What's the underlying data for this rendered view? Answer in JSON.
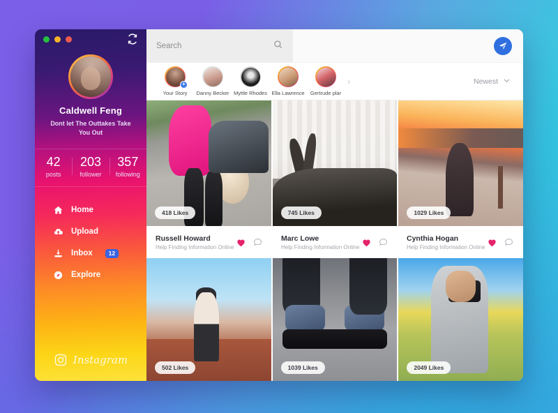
{
  "theme": {
    "bg_left": "#7b5fe8",
    "bg_right": "#35cbdf",
    "accent_blue": "#2f6fe0",
    "badge_blue": "#3a63e0",
    "heart_pink": "#e5236b"
  },
  "window": {
    "traffic_lights": [
      "green",
      "yellow",
      "red"
    ],
    "refresh_icon": "refresh-icon"
  },
  "sidebar": {
    "profile": {
      "name": "Caldwell Feng",
      "bio": "Dont let The Outtakes Take You Out",
      "avatar_icon": "user-avatar"
    },
    "stats": [
      {
        "num": "42",
        "label": "posts"
      },
      {
        "num": "203",
        "label": "follower"
      },
      {
        "num": "357",
        "label": "following"
      }
    ],
    "nav": [
      {
        "label": "Home",
        "icon": "home-icon",
        "badge": null
      },
      {
        "label": "Upload",
        "icon": "upload-cloud-icon",
        "badge": null
      },
      {
        "label": "Inbox",
        "icon": "inbox-download-icon",
        "badge": "12"
      },
      {
        "label": "Explore",
        "icon": "compass-icon",
        "badge": null
      }
    ],
    "brand": {
      "label": "Instagram",
      "icon": "instagram-icon"
    }
  },
  "topbar": {
    "search": {
      "value": "",
      "placeholder": "Search",
      "icon": "search-icon"
    },
    "send": {
      "icon": "send-paper-plane-icon"
    }
  },
  "stories": {
    "items": [
      {
        "name": "Your Story",
        "has_plus": true
      },
      {
        "name": "Danny Becker",
        "has_plus": false
      },
      {
        "name": "Myttle Rhodes",
        "has_plus": false
      },
      {
        "name": "Ella Lawrence",
        "has_plus": false
      },
      {
        "name": "Gertrude plar",
        "has_plus": false
      }
    ],
    "next_arrow": "chevron-right-icon",
    "sort": {
      "label": "Newest",
      "icon": "chevron-down-icon"
    }
  },
  "feed": {
    "rows": [
      {
        "posts": [
          {
            "likes": "418 Likes",
            "user": "Russell Howard",
            "caption": "Help Finding Information Online",
            "photo": "p1"
          },
          {
            "likes": "745 Likes",
            "user": "Marc Lowe",
            "caption": "Help Finding Information Online",
            "photo": "p2"
          },
          {
            "likes": "1029 Likes",
            "user": "Cynthia Hogan",
            "caption": "Help Finding Information Online",
            "photo": "p3"
          }
        ]
      },
      {
        "posts": [
          {
            "likes": "502 Likes",
            "photo": "p4"
          },
          {
            "likes": "1039 Likes",
            "photo": "p5"
          },
          {
            "likes": "2049 Likes",
            "photo": "p6"
          }
        ]
      }
    ]
  }
}
